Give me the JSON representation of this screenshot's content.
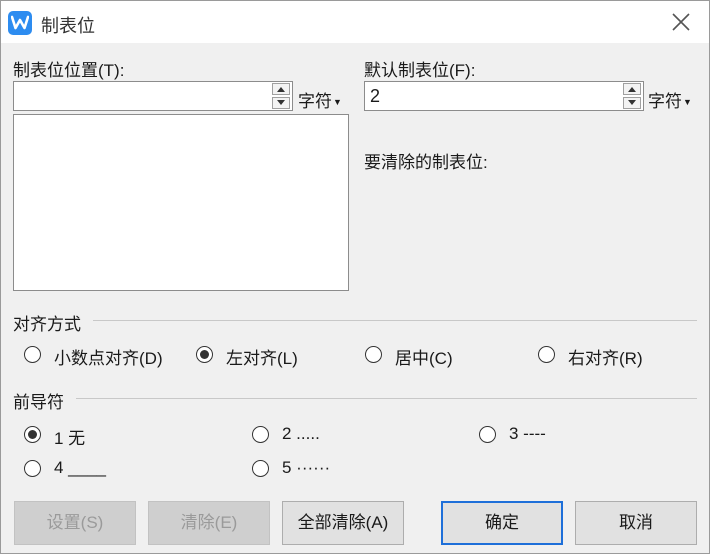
{
  "window": {
    "title": "制表位"
  },
  "tab_position": {
    "label": "制表位位置(T):",
    "value": "",
    "unit": "字符"
  },
  "default_tab": {
    "label": "默认制表位(F):",
    "value": "2",
    "unit": "字符"
  },
  "clear_label": "要清除的制表位:",
  "alignment": {
    "title": "对齐方式",
    "options": [
      {
        "label": "小数点对齐(D)",
        "selected": false
      },
      {
        "label": "左对齐(L)",
        "selected": true
      },
      {
        "label": "居中(C)",
        "selected": false
      },
      {
        "label": "右对齐(R)",
        "selected": false
      }
    ]
  },
  "leader": {
    "title": "前导符",
    "options": [
      {
        "label": "1 无",
        "selected": true
      },
      {
        "label": "2 .....",
        "selected": false
      },
      {
        "label": "3 ----",
        "selected": false
      },
      {
        "label": "4 ____",
        "selected": false
      },
      {
        "label": "5 ······",
        "selected": false
      }
    ]
  },
  "buttons": {
    "set": "设置(S)",
    "clear": "清除(E)",
    "clear_all": "全部清除(A)",
    "ok": "确定",
    "cancel": "取消"
  }
}
